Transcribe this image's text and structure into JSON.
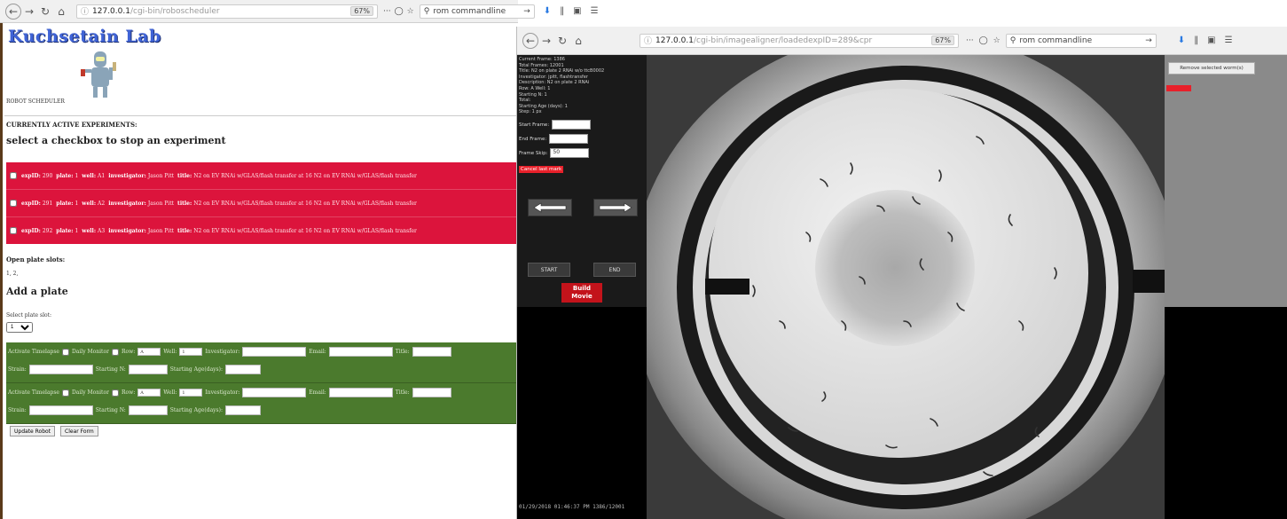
{
  "left_browser": {
    "url_host": "127.0.0.1",
    "url_path": "/cgi-bin/roboscheduler",
    "zoom": "67%",
    "search_text": "rom commandline",
    "more": "···"
  },
  "left_page": {
    "logo": "Kuchsetain Lab",
    "scheduler_label": "ROBOT SCHEDULER",
    "active_heading": "CURRENTLY ACTIVE EXPERIMENTS:",
    "stop_heading": "select a checkbox to stop an experiment",
    "experiments": [
      {
        "expid_label": "expID:",
        "expid": "290",
        "plate_label": "plate:",
        "plate": "1",
        "well_label": "well:",
        "well": "A1",
        "investigator_label": "investigator:",
        "investigator": "Jason Pitt",
        "title_label": "title:",
        "title": "N2 on EV RNAi w/GLAS/flash transfer at 16 N2 on EV RNAi w/GLAS/flash transfer"
      },
      {
        "expid_label": "expID:",
        "expid": "291",
        "plate_label": "plate:",
        "plate": "1",
        "well_label": "well:",
        "well": "A2",
        "investigator_label": "investigator:",
        "investigator": "Jason Pitt",
        "title_label": "title:",
        "title": "N2 on EV RNAi w/GLAS/flash transfer at 16 N2 on EV RNAi w/GLAS/flash transfer"
      },
      {
        "expid_label": "expID:",
        "expid": "292",
        "plate_label": "plate:",
        "plate": "1",
        "well_label": "well:",
        "well": "A3",
        "investigator_label": "investigator:",
        "investigator": "Jason Pitt",
        "title_label": "title:",
        "title": "N2 on EV RNAi w/GLAS/flash transfer at 16 N2 on EV RNAi w/GLAS/flash transfer"
      }
    ],
    "open_heading": "Open plate slots:",
    "open_slots": "1, 2,",
    "add_heading": "Add a plate",
    "select_label": "Select plate slot:",
    "slot_value": "1",
    "form_labels": {
      "timelapse": "Activate Timelapse",
      "daily": "Daily Monitor",
      "row": "Row:",
      "row_value": "A",
      "well": "Well:",
      "well_value": "1",
      "investigator": "Investigator:",
      "email": "Email:",
      "title": "Title:",
      "strain": "Strain:",
      "starting_n": "Starting N:",
      "starting_age": "Starting Age(days):"
    },
    "update_button": "Update Robot",
    "clear_button": "Clear Form"
  },
  "right_browser": {
    "url_host": "127.0.0.1",
    "url_path": "/cgi-bin/imagealigner/loadedexpID=289&cpr",
    "zoom": "67%",
    "search_text": "rom commandline",
    "more": "···"
  },
  "right_page": {
    "info_lines": [
      "Current Frame: 1386",
      "Total Frames: 12001",
      "Title: N2 on plate 2 RNAi w/o ttcB0002",
      "Investigator: jpitt, flashtransfer",
      "Description: N2 on plate 2 RNAi",
      "Row: A Well: 1",
      "Starting N: 1",
      "Total:",
      "Starting Age (days): 1",
      "Step: 1 px"
    ],
    "start_frame_label": "Start Frame:",
    "end_frame_label": "End Frame:",
    "frame_skip_label": "Frame Skip:",
    "frame_skip_value": "50",
    "cancel_label": "Cancel last mark",
    "start_label": "START",
    "end_label": "END",
    "build_label_1": "Build",
    "build_label_2": "Movie",
    "remove_label": "Remove selected worm(s)",
    "bottom_info": "01/29/2018 01:46:37 PM 1386/12001"
  },
  "colors": {
    "experiment_bg": "#dc143c",
    "form_bg": "#4b7a2d",
    "build_button": "#c3131b",
    "logo": "#3f63d6"
  }
}
